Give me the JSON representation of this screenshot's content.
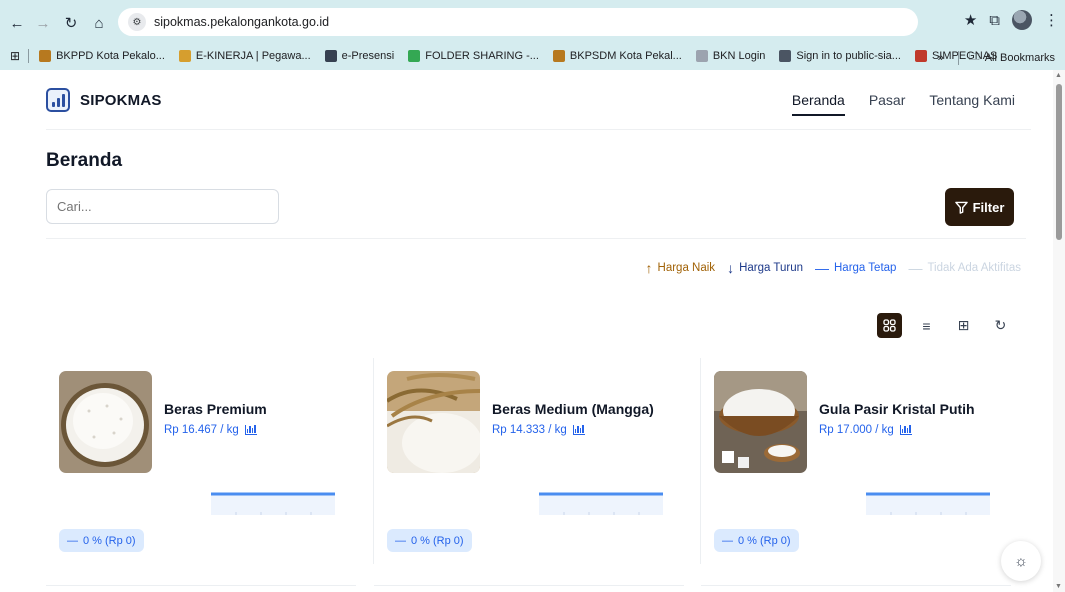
{
  "browser": {
    "url": "sipokmas.pekalongankota.go.id",
    "bookmarks": [
      {
        "label": "BKPPD Kota Pekalo...",
        "color": "#b7791f"
      },
      {
        "label": "E-KINERJA | Pegawa...",
        "color": "#d69e2e"
      },
      {
        "label": "e-Presensi",
        "color": "#374151"
      },
      {
        "label": "FOLDER SHARING -...",
        "color": "#34a853"
      },
      {
        "label": "BKPSDM Kota Pekal...",
        "color": "#b7791f"
      },
      {
        "label": "BKN Login",
        "color": "#9ca3af"
      },
      {
        "label": "Sign in to public-sia...",
        "color": "#4b5563"
      },
      {
        "label": "SIMPEGNAS",
        "color": "#c0392b"
      }
    ],
    "overflow_label": "»",
    "all_bookmarks_label": "All Bookmarks"
  },
  "nav": {
    "brand": "SIPOKMAS",
    "menu": [
      {
        "label": "Beranda",
        "active": true
      },
      {
        "label": "Pasar",
        "active": false
      },
      {
        "label": "Tentang Kami",
        "active": false
      }
    ]
  },
  "page": {
    "title": "Beranda",
    "search_placeholder": "Cari...",
    "filter_label": "Filter"
  },
  "legend": {
    "up": "Harga Naik",
    "down": "Harga Turun",
    "flat": "Harga Tetap",
    "none": "Tidak Ada Aktifitas"
  },
  "products": [
    {
      "name": "Beras Premium",
      "price": "Rp 16.467 / kg",
      "change": "0 % (Rp 0)",
      "image": "rice-bowl"
    },
    {
      "name": "Beras Medium (Mangga)",
      "price": "Rp 14.333 / kg",
      "change": "0 % (Rp 0)",
      "image": "rice-stalks"
    },
    {
      "name": "Gula Pasir Kristal Putih",
      "price": "Rp 17.000 / kg",
      "change": "0 % (Rp 0)",
      "image": "sugar-bowl"
    }
  ],
  "colors": {
    "accent_dark": "#2a1a0c",
    "price_blue": "#2563eb",
    "badge_bg": "#dbeafe",
    "chrome_bg": "#d5ecef"
  }
}
